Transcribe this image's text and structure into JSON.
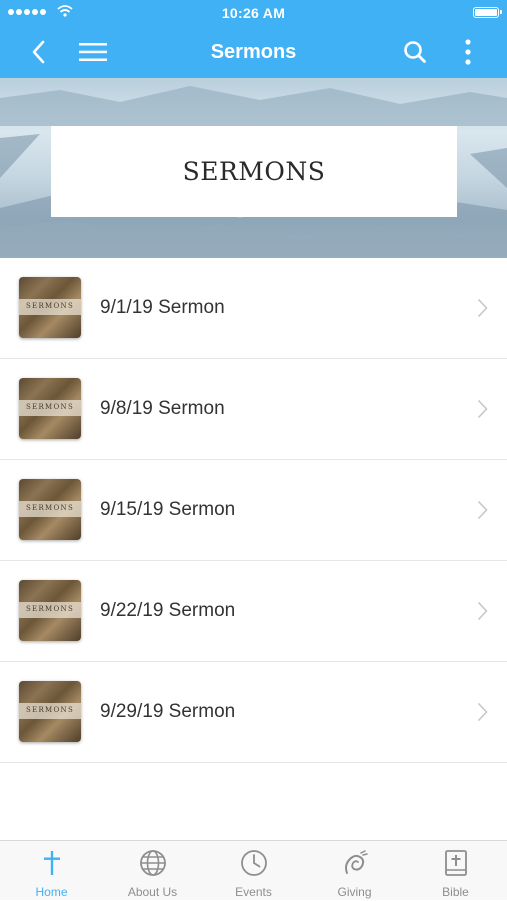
{
  "status_bar": {
    "time": "10:26 AM"
  },
  "header": {
    "title": "Sermons"
  },
  "banner": {
    "title": "SERMONS"
  },
  "sermons": [
    {
      "title": "9/1/19 Sermon",
      "thumb_text": "SERMONS"
    },
    {
      "title": "9/8/19 Sermon",
      "thumb_text": "SERMONS"
    },
    {
      "title": "9/15/19 Sermon",
      "thumb_text": "SERMONS"
    },
    {
      "title": "9/22/19 Sermon",
      "thumb_text": "SERMONS"
    },
    {
      "title": "9/29/19 Sermon",
      "thumb_text": "SERMONS"
    }
  ],
  "tabs": [
    {
      "label": "Home",
      "icon": "cross-icon",
      "active": true
    },
    {
      "label": "About Us",
      "icon": "globe-icon",
      "active": false
    },
    {
      "label": "Events",
      "icon": "clock-icon",
      "active": false
    },
    {
      "label": "Giving",
      "icon": "giving-icon",
      "active": false
    },
    {
      "label": "Bible",
      "icon": "bible-icon",
      "active": false
    }
  ],
  "colors": {
    "accent": "#3fb1f4",
    "inactive_tab": "#8e8e8e"
  }
}
